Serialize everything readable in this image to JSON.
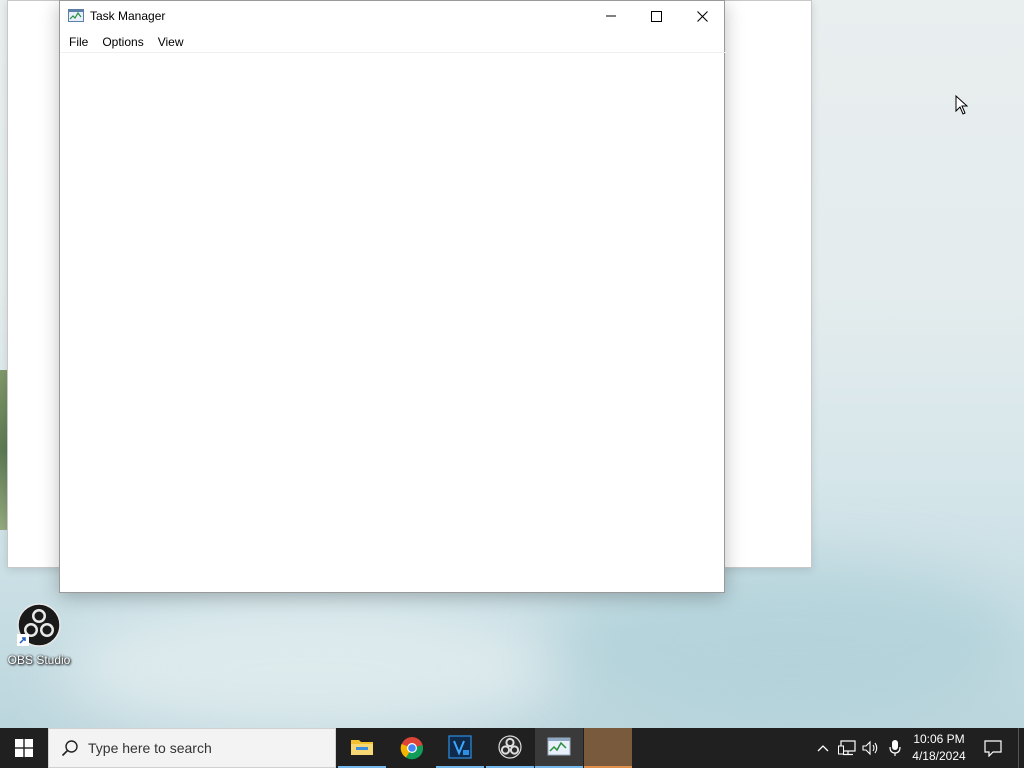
{
  "window": {
    "title": "Task Manager",
    "menu": [
      "File",
      "Options",
      "View"
    ]
  },
  "desktop": {
    "icons": [
      {
        "label": "OBS Studio",
        "icon": "obs-studio-icon"
      }
    ]
  },
  "taskbar": {
    "search_placeholder": "Type here to search",
    "apps": [
      {
        "name": "File Explorer",
        "icon": "file-explorer-icon",
        "state": "running"
      },
      {
        "name": "Google Chrome",
        "icon": "chrome-icon",
        "state": "running"
      },
      {
        "name": "Visual Studio",
        "icon": "visual-studio-icon",
        "state": "pinned"
      },
      {
        "name": "OBS Studio",
        "icon": "obs-studio-icon",
        "state": "running"
      },
      {
        "name": "Task Manager",
        "icon": "task-manager-icon",
        "state": "active"
      }
    ],
    "tray_icons": [
      "chevron-up-icon",
      "network-icon",
      "volume-icon",
      "microphone-icon"
    ],
    "clock": {
      "time": "10:06 PM",
      "date": "4/18/2024"
    }
  },
  "colors": {
    "taskbar_bg": "#202020",
    "running_indicator": "#76b9ed",
    "close_hover": "#e81123"
  }
}
